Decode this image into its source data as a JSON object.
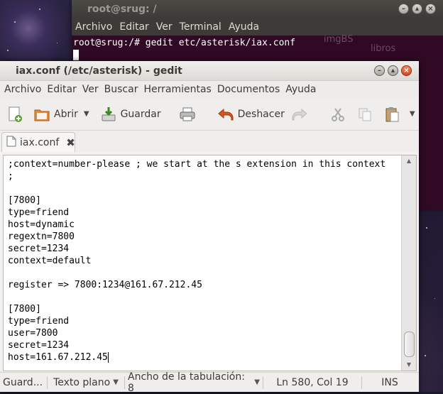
{
  "terminal": {
    "title": "root@srug: /",
    "menu": [
      "Archivo",
      "Editar",
      "Ver",
      "Terminal",
      "Ayuda"
    ],
    "prompt": "root@srug:/# gedit etc/asterisk/iax.conf",
    "background_texts": [
      "imgBS",
      "libros"
    ]
  },
  "gedit": {
    "title": "iax.conf (/etc/asterisk) - gedit",
    "menu": [
      "Archivo",
      "Editar",
      "Ver",
      "Buscar",
      "Herramientas",
      "Documentos",
      "Ayuda"
    ],
    "toolbar": {
      "open_label": "Abrir",
      "save_label": "Guardar",
      "undo_label": "Deshacer"
    },
    "tab": {
      "label": "iax.conf"
    },
    "editor_lines": [
      ";context=number-please ; we start at the s extension in this context",
      ";",
      "",
      "[7800]",
      "type=friend",
      "host=dynamic",
      "regextn=7800",
      "secret=1234",
      "context=default",
      "",
      "register => 7800:1234@161.67.212.45",
      "",
      "[7800]",
      "type=friend",
      "user=7800",
      "secret=1234",
      "host=161.67.212.45"
    ],
    "statusbar": {
      "saving": "Guard...",
      "language": "Texto plano",
      "tab_width": "Ancho de la tabulación:  8",
      "position": "Ln 580, Col 19",
      "mode": "INS"
    }
  },
  "colors": {
    "terminal_bg": "#300a24",
    "close_button": "#e05a26",
    "titlebar": "#dcdad5"
  }
}
